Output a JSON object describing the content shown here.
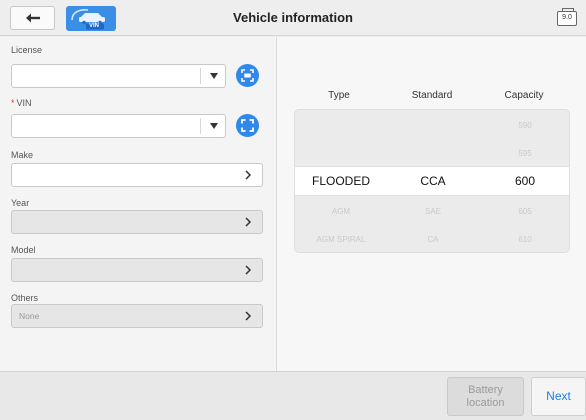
{
  "header": {
    "title": "Vehicle information",
    "back_icon": "back-arrow-icon",
    "logo_text": "VIN",
    "version_badge": "9.0"
  },
  "form": {
    "license": {
      "label": "License",
      "value": "",
      "scan_icon": "scan-plate-icon"
    },
    "vin": {
      "required_mark": "*",
      "label": "VIN",
      "value": "",
      "scan_icon": "scan-frame-icon"
    },
    "make": {
      "label": "Make",
      "value": ""
    },
    "year": {
      "label": "Year",
      "value": ""
    },
    "model": {
      "label": "Model",
      "value": ""
    },
    "others": {
      "label": "Others",
      "value": "None"
    }
  },
  "battery": {
    "columns": [
      "Type",
      "Standard",
      "Capacity"
    ],
    "rows": [
      [
        "",
        "",
        "590"
      ],
      [
        "",
        "",
        "595"
      ],
      [
        "FLOODED",
        "CCA",
        "600"
      ],
      [
        "AGM",
        "SAE",
        "605"
      ],
      [
        "AGM SPIRAL",
        "CA",
        "610"
      ]
    ],
    "selected_row": 2
  },
  "footer": {
    "battery_location_line1": "Battery",
    "battery_location_line2": "location",
    "next": "Next"
  },
  "colors": {
    "accent": "#2f88ea",
    "next_text": "#1e7fe6",
    "required": "#e53935"
  }
}
